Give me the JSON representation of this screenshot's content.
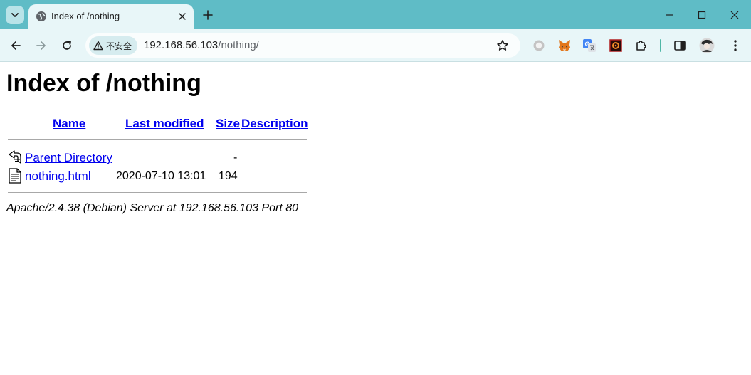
{
  "browser": {
    "tab": {
      "title": "Index of /nothing"
    },
    "omnibox": {
      "security_label": "不安全",
      "url_host": "192.168.56.103",
      "url_path": "/nothing/"
    },
    "icons": {
      "tab_search": "chevron-down-icon",
      "favicon": "globe-icon",
      "tab_close": "close-icon",
      "new_tab": "plus-icon",
      "minimize": "minimize-icon",
      "maximize": "maximize-icon",
      "window_close": "close-icon",
      "back": "back-arrow-icon",
      "forward": "forward-arrow-icon",
      "reload": "reload-icon",
      "warning": "warning-triangle-icon",
      "bookmark": "star-icon",
      "extensions": [
        "circle-extension-icon",
        "metamask-fox-icon",
        "translate-icon",
        "dark-extension-icon",
        "puzzle-icon"
      ],
      "side_panel": "side-panel-icon",
      "profile": "avatar",
      "menu": "kebab-menu-icon"
    },
    "colors": {
      "tabstrip": "#5fbcc6",
      "toolbar": "#e8f6f8",
      "link": "#0000ee"
    }
  },
  "page": {
    "heading": "Index of /nothing",
    "columns": {
      "name": "Name",
      "last_modified": "Last modified",
      "size": "Size",
      "description": "Description"
    },
    "rows": [
      {
        "icon": "back-folder-icon",
        "name": "Parent Directory",
        "last_modified": "",
        "size": "-",
        "description": ""
      },
      {
        "icon": "text-file-icon",
        "name": "nothing.html",
        "last_modified": "2020-07-10 13:01",
        "size": "194",
        "description": ""
      }
    ],
    "address": "Apache/2.4.38 (Debian) Server at 192.168.56.103 Port 80"
  }
}
